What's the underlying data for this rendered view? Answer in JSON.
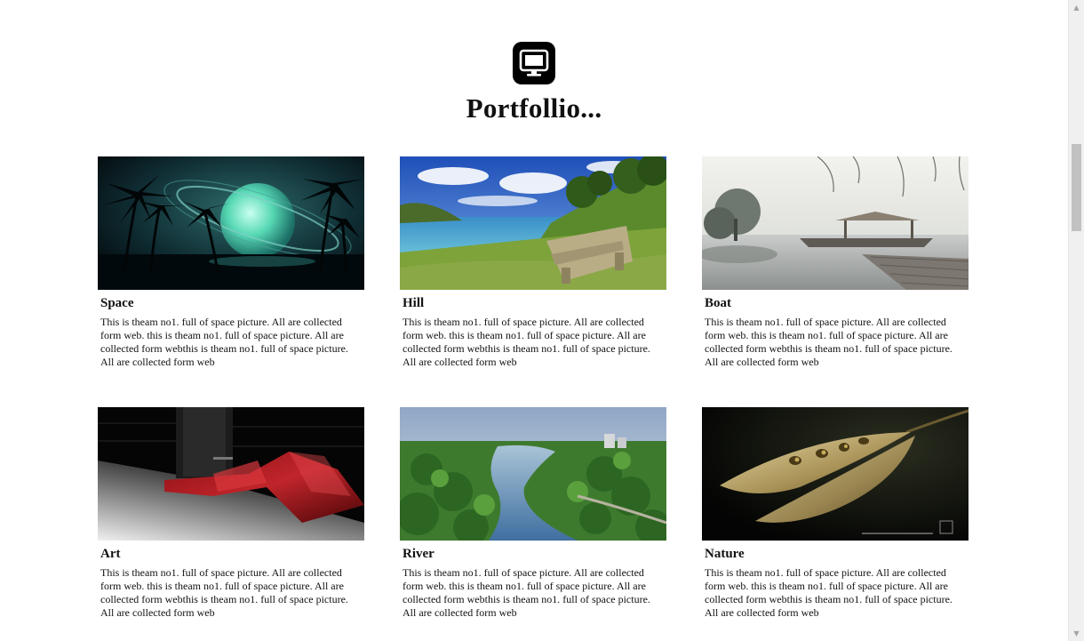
{
  "header": {
    "icon": "monitor-icon",
    "title": "Portfollio..."
  },
  "portfolio": {
    "items": [
      {
        "title": "Space",
        "image": "space-planet-palms-image",
        "description": "This is theam no1. full of space picture. All are collected form web. this is theam no1. full of space picture. All are collected form webthis is theam no1. full of space picture. All are collected form web"
      },
      {
        "title": "Hill",
        "image": "hill-bench-sea-image",
        "description": "This is theam no1. full of space picture. All are collected form web. this is theam no1. full of space picture. All are collected form webthis is theam no1. full of space picture. All are collected form web"
      },
      {
        "title": "Boat",
        "image": "boat-misty-lake-image",
        "description": "This is theam no1. full of space picture. All are collected form web. this is theam no1. full of space picture. All are collected form webthis is theam no1. full of space picture. All are collected form web"
      },
      {
        "title": "Art",
        "image": "red-abstract-art-image",
        "description": "This is theam no1. full of space picture. All are collected form web. this is theam no1. full of space picture. All are collected form webthis is theam no1. full of space picture. All are collected form web"
      },
      {
        "title": "River",
        "image": "river-aerial-image",
        "description": "This is theam no1. full of space picture. All are collected form web. this is theam no1. full of space picture. All are collected form webthis is theam no1. full of space picture. All are collected form web"
      },
      {
        "title": "Nature",
        "image": "seed-pod-image",
        "description": "This is theam no1. full of space picture. All are collected form web. this is theam no1. full of space picture. All are collected form webthis is theam no1. full of space picture. All are collected form web"
      }
    ]
  },
  "scrollbar": {
    "up_icon": "scroll-up-arrow-icon",
    "down_icon": "scroll-down-arrow-icon"
  }
}
